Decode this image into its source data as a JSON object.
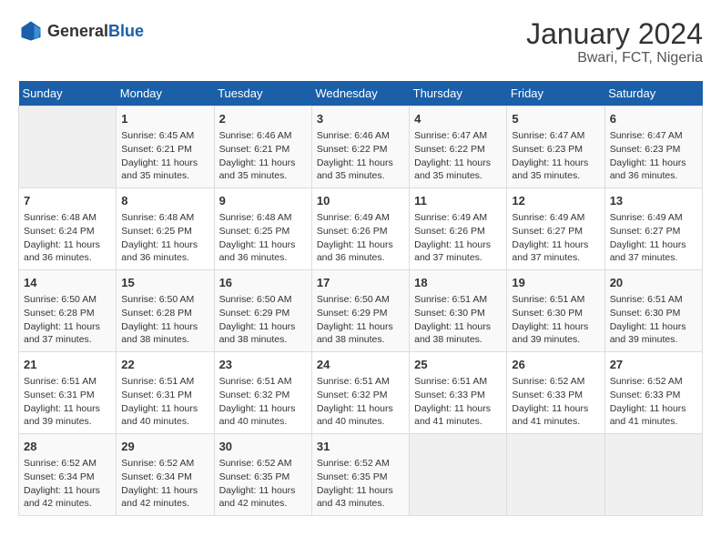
{
  "header": {
    "logo_general": "General",
    "logo_blue": "Blue",
    "title": "January 2024",
    "subtitle": "Bwari, FCT, Nigeria"
  },
  "weekdays": [
    "Sunday",
    "Monday",
    "Tuesday",
    "Wednesday",
    "Thursday",
    "Friday",
    "Saturday"
  ],
  "weeks": [
    [
      {
        "day": "",
        "detail": ""
      },
      {
        "day": "1",
        "detail": "Sunrise: 6:45 AM\nSunset: 6:21 PM\nDaylight: 11 hours\nand 35 minutes."
      },
      {
        "day": "2",
        "detail": "Sunrise: 6:46 AM\nSunset: 6:21 PM\nDaylight: 11 hours\nand 35 minutes."
      },
      {
        "day": "3",
        "detail": "Sunrise: 6:46 AM\nSunset: 6:22 PM\nDaylight: 11 hours\nand 35 minutes."
      },
      {
        "day": "4",
        "detail": "Sunrise: 6:47 AM\nSunset: 6:22 PM\nDaylight: 11 hours\nand 35 minutes."
      },
      {
        "day": "5",
        "detail": "Sunrise: 6:47 AM\nSunset: 6:23 PM\nDaylight: 11 hours\nand 35 minutes."
      },
      {
        "day": "6",
        "detail": "Sunrise: 6:47 AM\nSunset: 6:23 PM\nDaylight: 11 hours\nand 36 minutes."
      }
    ],
    [
      {
        "day": "7",
        "detail": "Sunrise: 6:48 AM\nSunset: 6:24 PM\nDaylight: 11 hours\nand 36 minutes."
      },
      {
        "day": "8",
        "detail": "Sunrise: 6:48 AM\nSunset: 6:25 PM\nDaylight: 11 hours\nand 36 minutes."
      },
      {
        "day": "9",
        "detail": "Sunrise: 6:48 AM\nSunset: 6:25 PM\nDaylight: 11 hours\nand 36 minutes."
      },
      {
        "day": "10",
        "detail": "Sunrise: 6:49 AM\nSunset: 6:26 PM\nDaylight: 11 hours\nand 36 minutes."
      },
      {
        "day": "11",
        "detail": "Sunrise: 6:49 AM\nSunset: 6:26 PM\nDaylight: 11 hours\nand 37 minutes."
      },
      {
        "day": "12",
        "detail": "Sunrise: 6:49 AM\nSunset: 6:27 PM\nDaylight: 11 hours\nand 37 minutes."
      },
      {
        "day": "13",
        "detail": "Sunrise: 6:49 AM\nSunset: 6:27 PM\nDaylight: 11 hours\nand 37 minutes."
      }
    ],
    [
      {
        "day": "14",
        "detail": "Sunrise: 6:50 AM\nSunset: 6:28 PM\nDaylight: 11 hours\nand 37 minutes."
      },
      {
        "day": "15",
        "detail": "Sunrise: 6:50 AM\nSunset: 6:28 PM\nDaylight: 11 hours\nand 38 minutes."
      },
      {
        "day": "16",
        "detail": "Sunrise: 6:50 AM\nSunset: 6:29 PM\nDaylight: 11 hours\nand 38 minutes."
      },
      {
        "day": "17",
        "detail": "Sunrise: 6:50 AM\nSunset: 6:29 PM\nDaylight: 11 hours\nand 38 minutes."
      },
      {
        "day": "18",
        "detail": "Sunrise: 6:51 AM\nSunset: 6:30 PM\nDaylight: 11 hours\nand 38 minutes."
      },
      {
        "day": "19",
        "detail": "Sunrise: 6:51 AM\nSunset: 6:30 PM\nDaylight: 11 hours\nand 39 minutes."
      },
      {
        "day": "20",
        "detail": "Sunrise: 6:51 AM\nSunset: 6:30 PM\nDaylight: 11 hours\nand 39 minutes."
      }
    ],
    [
      {
        "day": "21",
        "detail": "Sunrise: 6:51 AM\nSunset: 6:31 PM\nDaylight: 11 hours\nand 39 minutes."
      },
      {
        "day": "22",
        "detail": "Sunrise: 6:51 AM\nSunset: 6:31 PM\nDaylight: 11 hours\nand 40 minutes."
      },
      {
        "day": "23",
        "detail": "Sunrise: 6:51 AM\nSunset: 6:32 PM\nDaylight: 11 hours\nand 40 minutes."
      },
      {
        "day": "24",
        "detail": "Sunrise: 6:51 AM\nSunset: 6:32 PM\nDaylight: 11 hours\nand 40 minutes."
      },
      {
        "day": "25",
        "detail": "Sunrise: 6:51 AM\nSunset: 6:33 PM\nDaylight: 11 hours\nand 41 minutes."
      },
      {
        "day": "26",
        "detail": "Sunrise: 6:52 AM\nSunset: 6:33 PM\nDaylight: 11 hours\nand 41 minutes."
      },
      {
        "day": "27",
        "detail": "Sunrise: 6:52 AM\nSunset: 6:33 PM\nDaylight: 11 hours\nand 41 minutes."
      }
    ],
    [
      {
        "day": "28",
        "detail": "Sunrise: 6:52 AM\nSunset: 6:34 PM\nDaylight: 11 hours\nand 42 minutes."
      },
      {
        "day": "29",
        "detail": "Sunrise: 6:52 AM\nSunset: 6:34 PM\nDaylight: 11 hours\nand 42 minutes."
      },
      {
        "day": "30",
        "detail": "Sunrise: 6:52 AM\nSunset: 6:35 PM\nDaylight: 11 hours\nand 42 minutes."
      },
      {
        "day": "31",
        "detail": "Sunrise: 6:52 AM\nSunset: 6:35 PM\nDaylight: 11 hours\nand 43 minutes."
      },
      {
        "day": "",
        "detail": ""
      },
      {
        "day": "",
        "detail": ""
      },
      {
        "day": "",
        "detail": ""
      }
    ]
  ]
}
